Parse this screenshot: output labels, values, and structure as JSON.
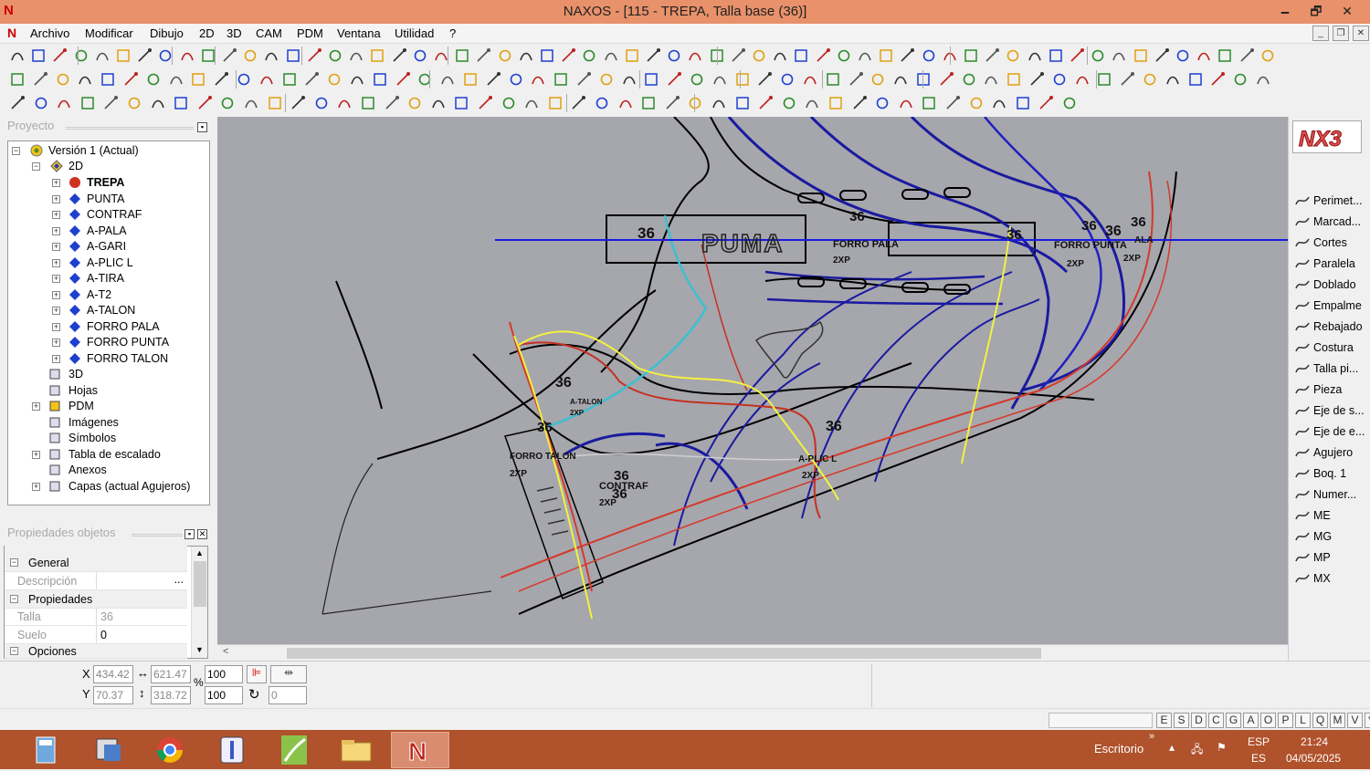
{
  "window": {
    "title": "NAXOS - [115 - TREPA, Talla base (36)]",
    "minimize": "🗕",
    "maximize": "🗗",
    "close": "✕"
  },
  "menu": {
    "items": [
      "Archivo",
      "Modificar",
      "Dibujo",
      "2D",
      "3D",
      "CAM",
      "PDM",
      "Ventana",
      "Utilidad",
      "?"
    ]
  },
  "project": {
    "title": "Proyecto",
    "tree": {
      "version": "Versión 1 (Actual)",
      "2d": "2D",
      "layers": [
        "TREPA",
        "PUNTA",
        "CONTRAF",
        "A-PALA",
        "A-GARI",
        "A-PLIC L",
        "A-TIRA",
        "A-T2",
        "A-TALON",
        "FORRO PALA",
        "FORRO PUNTA",
        "FORRO TALON"
      ],
      "others": [
        "3D",
        "Hojas",
        "PDM",
        "Imágenes",
        "Símbolos",
        "Tabla de escalado",
        "Anexos",
        "Capas (actual Agujeros)"
      ]
    }
  },
  "properties": {
    "title": "Propiedades objetos",
    "general": "General",
    "descripcion_label": "Descripción",
    "descripcion_value": "...",
    "propiedades": "Propiedades",
    "talla_label": "Talla",
    "talla_value": "36",
    "suelo_label": "Suelo",
    "suelo_value": "0",
    "opciones": "Opciones"
  },
  "tools": [
    "Perimet...",
    "Marcad...",
    "Cortes",
    "Paralela",
    "Doblado",
    "Empalme",
    "Rebajado",
    "Costura",
    "Talla pi...",
    "Pieza",
    "Eje de s...",
    "Eje de e...",
    "Agujero",
    "Boq. 1",
    "Numer...",
    "ME",
    "MG",
    "MP",
    "MX"
  ],
  "status": {
    "x_label": "X",
    "y_label": "Y",
    "x": "434.42",
    "y": "70.37",
    "w": "621.47",
    "h": "318.72",
    "scale_x": "100",
    "scale_y": "100",
    "percent": "%",
    "angle": "0"
  },
  "layers_bar": [
    "E",
    "S",
    "D",
    "C",
    "G",
    "A",
    "O",
    "P",
    "L",
    "Q",
    "M",
    "V"
  ],
  "canvas_labels": {
    "size": "36",
    "puma": "PUMA",
    "forro_pala": "FORRO PALA",
    "forro_punta": "FORRO PUNTA",
    "forro_talon": "FORRO TALON",
    "a_talon": "A-TALON",
    "contraf": "CONTRAF",
    "a_plic": "A-PLIC L",
    "xp": "2XP",
    "ala": "ALA"
  },
  "taskbar": {
    "desktop": "Escritorio",
    "lang1": "ESP",
    "lang2": "ES",
    "time": "21:24",
    "date": "04/05/2025"
  },
  "colors": {
    "titlebar": "#e8916a",
    "taskbar": "#b0522c",
    "canvas": "#a6a6ad"
  }
}
